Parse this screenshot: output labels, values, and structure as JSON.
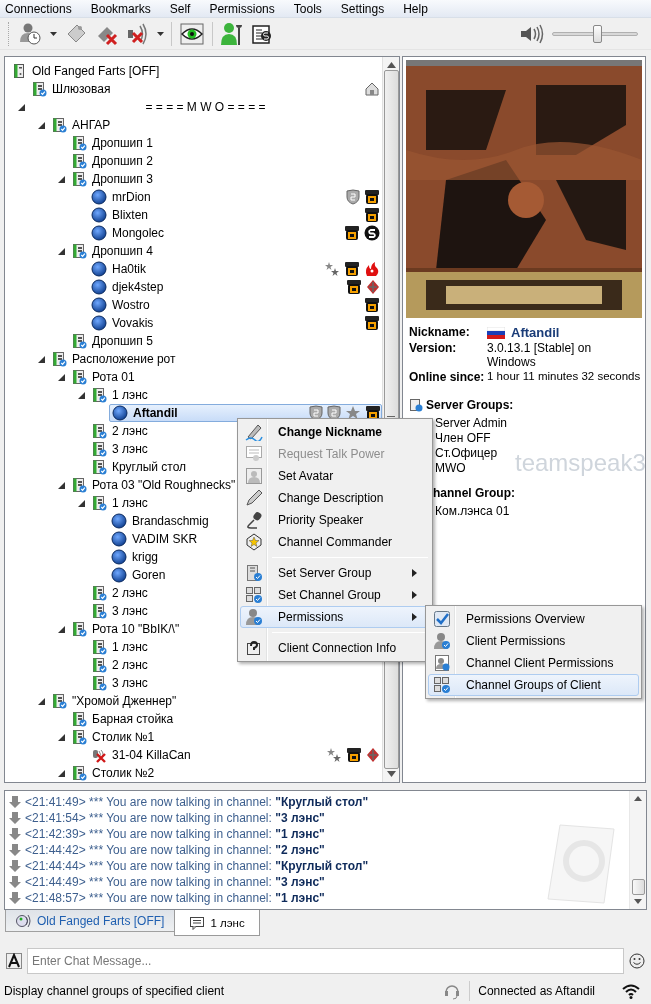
{
  "menubar": [
    "Connections",
    "Bookmarks",
    "Self",
    "Permissions",
    "Tools",
    "Settings",
    "Help"
  ],
  "toolbar": {
    "volume": {
      "level": 0.52
    }
  },
  "tree": {
    "label": "Old Fanged Farts [OFF]",
    "kind": "server",
    "selected": false,
    "children": [
      {
        "label": "Шлюзовая",
        "kind": "channel",
        "selected": false,
        "badges": [
          {
            "kind": "home"
          }
        ]
      },
      {
        "label": "= = = = M W O = = = =",
        "kind": "spacer",
        "selected": false,
        "expanded": true,
        "children": [
          {
            "label": "АНГАР",
            "kind": "channel",
            "selected": false,
            "expanded": true,
            "children": [
              {
                "label": "Дропшип 1",
                "kind": "channel",
                "selected": false
              },
              {
                "label": "Дропшип 2",
                "kind": "channel",
                "selected": false
              },
              {
                "label": "Дропшип 3",
                "kind": "channel",
                "selected": false,
                "expanded": true,
                "children": [
                  {
                    "label": "mrDion",
                    "kind": "client",
                    "selected": false,
                    "badges": [
                      {
                        "kind": "shield"
                      },
                      {
                        "kind": "emblem"
                      }
                    ]
                  },
                  {
                    "label": "Blixten",
                    "kind": "client",
                    "selected": false,
                    "badges": [
                      {
                        "kind": "emblem"
                      }
                    ]
                  },
                  {
                    "label": "Mongolec",
                    "kind": "client",
                    "selected": false,
                    "badges": [
                      {
                        "kind": "emblem"
                      },
                      {
                        "kind": "ring"
                      }
                    ]
                  }
                ]
              },
              {
                "label": "Дропшип 4",
                "kind": "channel",
                "selected": false,
                "expanded": true,
                "children": [
                  {
                    "label": "Ha0tik",
                    "kind": "client",
                    "selected": false,
                    "badges": [
                      {
                        "kind": "stars"
                      },
                      {
                        "kind": "emblem"
                      },
                      {
                        "kind": "flame"
                      }
                    ]
                  },
                  {
                    "label": "djek4step",
                    "kind": "client",
                    "selected": false,
                    "badges": [
                      {
                        "kind": "emblem"
                      },
                      {
                        "kind": "diamond"
                      }
                    ]
                  },
                  {
                    "label": "Wostro",
                    "kind": "client",
                    "selected": false,
                    "badges": [
                      {
                        "kind": "emblem"
                      }
                    ]
                  },
                  {
                    "label": "Vovakis",
                    "kind": "client",
                    "selected": false,
                    "badges": [
                      {
                        "kind": "emblem"
                      }
                    ]
                  }
                ]
              },
              {
                "label": "Дропшип 5",
                "kind": "channel",
                "selected": false
              }
            ]
          },
          {
            "label": "Расположение рот",
            "kind": "channel",
            "selected": false,
            "expanded": true,
            "children": [
              {
                "label": "Рота 01",
                "kind": "channel",
                "selected": false,
                "expanded": true,
                "children": [
                  {
                    "label": "1 лэнс",
                    "kind": "channel",
                    "selected": false,
                    "expanded": true,
                    "children": [
                      {
                        "label": "Aftandil",
                        "kind": "client",
                        "selected": true,
                        "badges": [
                          {
                            "kind": "shield"
                          },
                          {
                            "kind": "shield"
                          },
                          {
                            "kind": "star"
                          },
                          {
                            "kind": "emblem"
                          }
                        ]
                      }
                    ]
                  },
                  {
                    "label": "2 лэнс",
                    "kind": "channel",
                    "selected": false
                  },
                  {
                    "label": "3 лэнс",
                    "kind": "channel",
                    "selected": false
                  },
                  {
                    "label": "Круглый стол",
                    "kind": "channel",
                    "selected": false
                  }
                ]
              },
              {
                "label": "Рота 03 \"Old Roughnecks\"",
                "kind": "channel",
                "selected": false,
                "expanded": true,
                "children": [
                  {
                    "label": "1 лэнс",
                    "kind": "channel",
                    "selected": false,
                    "expanded": true,
                    "children": [
                      {
                        "label": "Brandaschmig",
                        "kind": "client",
                        "selected": false
                      },
                      {
                        "label": "VADIM SKR",
                        "kind": "client",
                        "selected": false
                      },
                      {
                        "label": "krigg",
                        "kind": "client",
                        "selected": false
                      },
                      {
                        "label": "Goren",
                        "kind": "client",
                        "selected": false
                      }
                    ]
                  },
                  {
                    "label": "2 лэнс",
                    "kind": "channel",
                    "selected": false
                  },
                  {
                    "label": "3 лэнс",
                    "kind": "channel",
                    "selected": false
                  }
                ]
              },
              {
                "label": "Рота 10 \"BbIK/\\\"",
                "kind": "channel",
                "selected": false,
                "expanded": true,
                "children": [
                  {
                    "label": "1 лэнс",
                    "kind": "channel",
                    "selected": false
                  },
                  {
                    "label": "2 лэнс",
                    "kind": "channel",
                    "selected": false
                  },
                  {
                    "label": "3 лэнс",
                    "kind": "channel",
                    "selected": false
                  }
                ]
              }
            ]
          },
          {
            "label": "\"Хромой Дженнер\"",
            "kind": "channel",
            "selected": false,
            "expanded": true,
            "children": [
              {
                "label": "Барная стойка",
                "kind": "channel",
                "selected": false
              },
              {
                "label": "Столик №1",
                "kind": "channel",
                "selected": false,
                "expanded": true,
                "children": [
                  {
                    "label": "31-04 KillaCan",
                    "kind": "client-muted",
                    "selected": false,
                    "badges": [
                      {
                        "kind": "stars"
                      },
                      {
                        "kind": "emblem"
                      },
                      {
                        "kind": "diamond"
                      }
                    ]
                  }
                ]
              },
              {
                "label": "Столик №2",
                "kind": "channel",
                "selected": false,
                "expanded": true
              }
            ]
          }
        ]
      }
    ]
  },
  "client_info": {
    "avatar": {
      "kind": "picture"
    },
    "nickname_label": "Nickname:",
    "nickname": "Aftandil",
    "version_label": "Version:",
    "version": "3.0.13.1 [Stable] on Windows",
    "online_label": "Online since:",
    "online": "1 hour 11 minutes 32 seconds",
    "server_groups_label": "Server Groups:",
    "server_groups": [
      "Server Admin",
      "Член OFF",
      "Ст.Офицер",
      "MWO"
    ],
    "channel_group_label": "hannel Group:",
    "channel_group": "Ком.лэнса 01",
    "watermark": "teamspeak3"
  },
  "context_menu": {
    "groups": [
      [
        {
          "label": "Change Nickname",
          "kind": "pen",
          "default": true,
          "disabled": false,
          "has_submenu": false,
          "selected": false
        },
        {
          "label": "Request Talk Power",
          "kind": "request",
          "default": false,
          "disabled": true,
          "has_submenu": false,
          "selected": false
        },
        {
          "label": "Set Avatar",
          "kind": "avatar",
          "default": false,
          "disabled": false,
          "has_submenu": false,
          "selected": false
        },
        {
          "label": "Change Description",
          "kind": "pencil",
          "default": false,
          "disabled": false,
          "has_submenu": false,
          "selected": false
        },
        {
          "label": "Priority Speaker",
          "kind": "mic",
          "default": false,
          "disabled": false,
          "has_submenu": false,
          "selected": false
        },
        {
          "label": "Channel Commander",
          "kind": "commander",
          "default": false,
          "disabled": false,
          "has_submenu": false,
          "selected": false
        }
      ],
      [
        {
          "label": "Set Server Group",
          "kind": "server-group",
          "default": false,
          "disabled": false,
          "has_submenu": true,
          "selected": false
        },
        {
          "label": "Set Channel Group",
          "kind": "channel-group",
          "default": false,
          "disabled": false,
          "has_submenu": true,
          "selected": false
        },
        {
          "label": "Permissions",
          "kind": "permissions",
          "default": false,
          "disabled": false,
          "has_submenu": true,
          "selected": true
        }
      ],
      [
        {
          "label": "Client Connection Info",
          "kind": "info",
          "default": false,
          "disabled": false,
          "has_submenu": false,
          "selected": false
        }
      ]
    ],
    "submenu": [
      {
        "label": "Permissions Overview",
        "kind": "check",
        "selected": false
      },
      {
        "label": "Client Permissions",
        "kind": "permissions",
        "selected": false
      },
      {
        "label": "Channel Client Permissions",
        "kind": "channel-client",
        "selected": false
      },
      {
        "label": "Channel Groups of Client",
        "kind": "channel-group",
        "selected": true
      }
    ]
  },
  "chat": {
    "messages": [
      {
        "text": "<21:41:49> *** You are now talking in channel:",
        "channel": "\"Круглый стол\""
      },
      {
        "text": "<21:41:54> *** You are now talking in channel:",
        "channel": "\"3 лэнс\""
      },
      {
        "text": "<21:42:39> *** You are now talking in channel:",
        "channel": "\"1 лэнс\""
      },
      {
        "text": "<21:44:42> *** You are now talking in channel:",
        "channel": "\"2 лэнс\""
      },
      {
        "text": "<21:44:44> *** You are now talking in channel:",
        "channel": "\"Круглый стол\""
      },
      {
        "text": "<21:44:49> *** You are now talking in channel:",
        "channel": "\"3 лэнс\""
      },
      {
        "text": "<21:48:57> *** You are now talking in channel:",
        "channel": "\"1 лэнс\""
      }
    ],
    "tabs": [
      {
        "label": "Old Fanged Farts [OFF]",
        "kind": "server",
        "selected": false
      },
      {
        "label": "1 лэнс",
        "kind": "channel",
        "selected": true
      }
    ],
    "input": {
      "placeholder": "Enter Chat Message..."
    }
  },
  "status_bar": {
    "message": "Display channel groups of specified client",
    "connection": "Connected as Aftandil"
  }
}
